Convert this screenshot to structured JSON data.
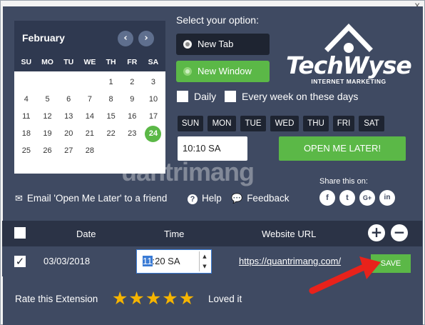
{
  "window": {
    "close_glyph": "x"
  },
  "calendar": {
    "month": "February",
    "prev_glyph": "‹",
    "next_glyph": "›",
    "dow": [
      "SU",
      "MO",
      "TU",
      "WE",
      "TH",
      "FR",
      "SA"
    ],
    "days": [
      "",
      "",
      "",
      "",
      "1",
      "2",
      "3",
      "4",
      "5",
      "6",
      "7",
      "8",
      "9",
      "10",
      "11",
      "12",
      "13",
      "14",
      "15",
      "16",
      "17",
      "18",
      "19",
      "20",
      "21",
      "22",
      "23",
      "24",
      "25",
      "26",
      "27",
      "28"
    ],
    "selected": "24"
  },
  "options": {
    "title": "Select your option:",
    "new_tab": "New Tab",
    "new_window": "New Window"
  },
  "logo": {
    "word": "TechWyse",
    "tagline": "INTERNET MARKETING"
  },
  "schedule": {
    "daily": "Daily",
    "every_week": "Every week on these days",
    "weekdays": [
      "SUN",
      "MON",
      "TUE",
      "WED",
      "THU",
      "FRI",
      "SAT"
    ],
    "time_value": "10:10 SA",
    "open_later": "OPEN ME LATER!"
  },
  "footer_links": {
    "email": "Email 'Open Me Later' to a friend",
    "help": "Help",
    "feedback": "Feedback"
  },
  "share": {
    "label": "Share this on:",
    "icons": [
      "facebook-icon",
      "twitter-icon",
      "google-plus-icon",
      "linkedin-icon"
    ],
    "glyphs": [
      "f",
      "t",
      "G+",
      "in"
    ]
  },
  "table": {
    "headers": {
      "date": "Date",
      "time": "Time",
      "url": "Website URL"
    },
    "add_glyph": "+",
    "remove_glyph": "−",
    "rows": [
      {
        "checked": "✓",
        "date": "03/03/2018",
        "time_hour": "11",
        "time_rest": ":20 SA",
        "url": "https://quantrimang.com/",
        "save": "SAVE"
      }
    ]
  },
  "rating": {
    "label": "Rate this Extension",
    "stars": 5,
    "loved": "Loved it"
  },
  "watermark": "uantrimang",
  "colors": {
    "panel": "#3f4a62",
    "dark": "#1e2431",
    "accent_green": "#5bb847",
    "star": "#f5b400",
    "arrow": "#e8221b"
  }
}
